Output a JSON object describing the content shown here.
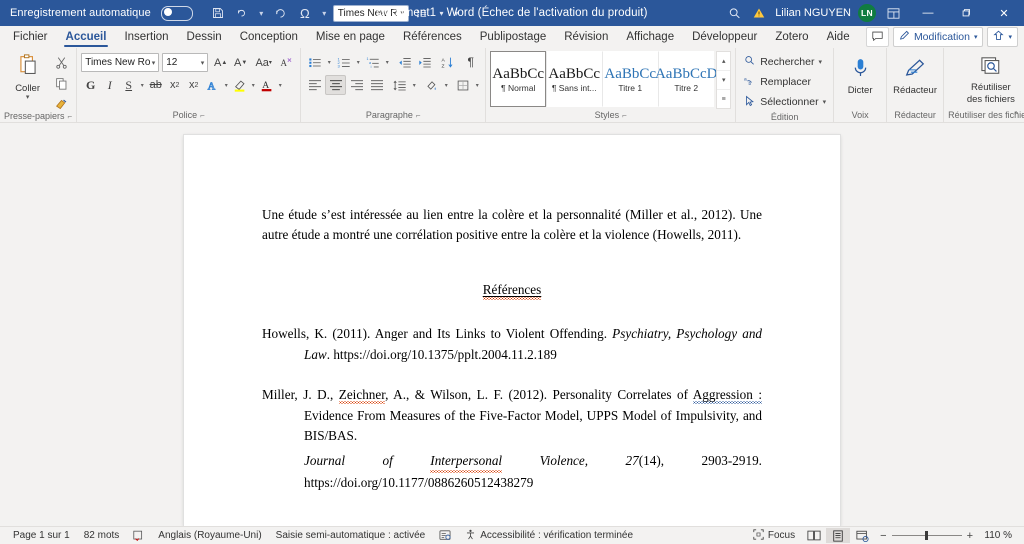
{
  "titlebar": {
    "autosave_label": "Enregistrement automatique",
    "autosave_state": "off",
    "quick_access": [
      {
        "name": "save-icon",
        "glyph": "💾"
      },
      {
        "name": "undo-icon",
        "glyph": "↶"
      },
      {
        "name": "redo-icon",
        "glyph": "↻"
      },
      {
        "name": "omega-icon",
        "glyph": "Ω"
      }
    ],
    "font_chip": "Times New R",
    "line_spacing_icon": "line-spacing-icon",
    "more_icon": "more-commands-icon",
    "document_title": "Document1  -  Word (Échec de l'activation du produit)",
    "search_icon": "search-icon",
    "warning_icon": "warning-icon",
    "user_name": "Lilian NGUYEN",
    "avatar_initials": "LN",
    "ribbon_display_icon": "ribbon-display-options-icon",
    "minimize": "—",
    "maximize": "❐",
    "close": "✕",
    "bg_color": "#2b579a"
  },
  "tabs": [
    {
      "label": "Fichier",
      "active": false
    },
    {
      "label": "Accueil",
      "active": true
    },
    {
      "label": "Insertion",
      "active": false
    },
    {
      "label": "Dessin",
      "active": false
    },
    {
      "label": "Conception",
      "active": false
    },
    {
      "label": "Mise en page",
      "active": false
    },
    {
      "label": "Références",
      "active": false
    },
    {
      "label": "Publipostage",
      "active": false
    },
    {
      "label": "Révision",
      "active": false
    },
    {
      "label": "Affichage",
      "active": false
    },
    {
      "label": "Développeur",
      "active": false
    },
    {
      "label": "Zotero",
      "active": false
    },
    {
      "label": "Aide",
      "active": false
    }
  ],
  "tabs_right": {
    "comments_icon": "comment-icon",
    "editing_label": "Modification",
    "share_icon": "share-icon"
  },
  "ribbon": {
    "clipboard": {
      "title": "Presse-papiers",
      "paste_label": "Coller",
      "paste_icon": "paste-icon",
      "cut_icon": "scissors-icon",
      "copy_icon": "copy-icon",
      "format_painter_icon": "format-painter-icon",
      "dialog_launcher": "dialog-launcher-icon"
    },
    "font": {
      "title": "Police",
      "font_name": "Times New Ro",
      "font_size": "12",
      "grow_icon": "grow-font-icon",
      "shrink_icon": "shrink-font-icon",
      "change_case_icon": "change-case-icon",
      "clear_format_icon": "clear-formatting-icon",
      "bold": "G",
      "italic": "I",
      "underline": "S",
      "strikethrough_icon": "strikethrough-icon",
      "subscript_icon": "subscript-icon",
      "superscript_icon": "superscript-icon",
      "text_effects_icon": "text-effects-icon",
      "highlight_icon": "highlight-color-icon",
      "font_color_icon": "font-color-icon",
      "dialog_launcher": "dialog-launcher-icon"
    },
    "paragraph": {
      "title": "Paragraphe",
      "bullets_icon": "bullet-list-icon",
      "numbering_icon": "numbered-list-icon",
      "multilevel_icon": "multilevel-list-icon",
      "decrease_indent_icon": "decrease-indent-icon",
      "increase_indent_icon": "increase-indent-icon",
      "sort_icon": "sort-icon",
      "show_marks_icon": "paragraph-marks-icon",
      "align_left_icon": "align-left-icon",
      "align_center_icon": "align-center-icon",
      "align_right_icon": "align-right-icon",
      "justify_icon": "justify-icon",
      "line_spacing_icon": "line-spacing-icon",
      "shading_icon": "shading-icon",
      "borders_icon": "borders-icon",
      "dialog_launcher": "dialog-launcher-icon"
    },
    "styles": {
      "title": "Styles",
      "items": [
        {
          "sample": "AaBbCc",
          "name": "¶ Normal",
          "selected": true,
          "blue": false
        },
        {
          "sample": "AaBbCc",
          "name": "¶ Sans int...",
          "selected": false,
          "blue": false
        },
        {
          "sample": "AaBbCc",
          "name": "Titre 1",
          "selected": false,
          "blue": true
        },
        {
          "sample": "AaBbCcD",
          "name": "Titre 2",
          "selected": false,
          "blue": true
        }
      ],
      "scroll_up_icon": "scroll-up-icon",
      "scroll_down_icon": "scroll-down-icon",
      "more_styles_icon": "more-styles-icon",
      "dialog_launcher": "dialog-launcher-icon"
    },
    "edition": {
      "title": "Édition",
      "find_label": "Rechercher",
      "find_icon": "search-icon",
      "replace_label": "Remplacer",
      "replace_icon": "replace-icon",
      "select_label": "Sélectionner",
      "select_icon": "select-icon"
    },
    "voice": {
      "title": "Voix",
      "dictate_label": "Dicter",
      "dictate_icon": "microphone-icon"
    },
    "editor": {
      "title": "Rédacteur",
      "label": "Rédacteur",
      "icon": "editor-pen-icon"
    },
    "reuse": {
      "title": "Réutiliser des fichiers",
      "label_line1": "Réutiliser",
      "label_line2": "des fichiers",
      "icon": "reuse-files-icon"
    },
    "collapse_icon": "collapse-ribbon-icon"
  },
  "document": {
    "paragraph1": "Une étude s’est intéressée au lien entre la colère et la personnalité (Miller et al., 2012). Une autre étude a montré une corrélation positive entre la colère et la violence (Howells, 2011).",
    "references_heading": "Références",
    "ref1": {
      "part1": "Howells, K. (2011). Anger and Its Links to Violent Offending. ",
      "italic1": "Psychiatry, Psychology and Law",
      "part2": ". https://doi.org/10.1375/pplt.2004.11.2.189"
    },
    "ref2": {
      "part1": "Miller, J. D., ",
      "misspelled": "Zeichner",
      "part2": ", A., & Wilson, L. F. (2012). Personality Correlates of ",
      "grammar_flag": "Aggression :",
      "part3": " Evidence From Measures of the Five-Factor Model, UPPS Model of Impulsivity, and BIS/BAS. ",
      "journal_a": "Journal",
      "journal_of": "of",
      "journal_b": "Interpersonal",
      "journal_c": "Violence,",
      "volume": "27",
      "issue": "(14),",
      "pages": "2903-2919.",
      "doi": "https://doi.org/10.1177/0886260512438279"
    }
  },
  "statusbar": {
    "page_label": "Page 1 sur 1",
    "word_count": "82 mots",
    "proofing_icon": "proofing-errors-icon",
    "language": "Anglais (Royaume-Uni)",
    "typing_mode": "Saisie semi-automatique : activée",
    "track_changes_icon": "track-changes-icon",
    "accessibility_icon": "accessibility-icon",
    "accessibility": "Accessibilité : vérification terminée",
    "focus_icon": "focus-icon",
    "focus_label": "Focus",
    "view_read_icon": "read-mode-icon",
    "view_print_icon": "print-layout-icon",
    "view_web_icon": "web-layout-icon",
    "zoom_out": "−",
    "zoom_in": "+",
    "zoom_value": "110 %"
  }
}
